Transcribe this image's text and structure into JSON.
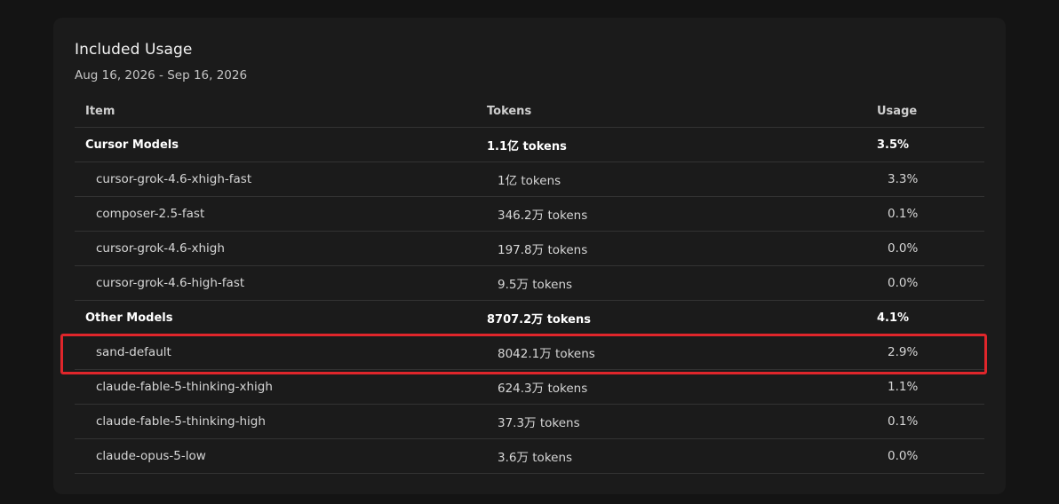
{
  "usage": {
    "title": "Included Usage",
    "date_range": "Aug 16, 2026 - Sep 16, 2026",
    "headers": {
      "item": "Item",
      "tokens": "Tokens",
      "usage": "Usage"
    },
    "groups": [
      {
        "name": "Cursor Models",
        "tokens": "1.1亿 tokens",
        "usage": "3.5%",
        "items": [
          {
            "name": "cursor-grok-4.6-xhigh-fast",
            "tokens": "1亿 tokens",
            "usage": "3.3%"
          },
          {
            "name": "composer-2.5-fast",
            "tokens": "346.2万 tokens",
            "usage": "0.1%"
          },
          {
            "name": "cursor-grok-4.6-xhigh",
            "tokens": "197.8万 tokens",
            "usage": "0.0%"
          },
          {
            "name": "cursor-grok-4.6-high-fast",
            "tokens": "9.5万 tokens",
            "usage": "0.0%"
          }
        ]
      },
      {
        "name": "Other Models",
        "tokens": "8707.2万 tokens",
        "usage": "4.1%",
        "items": [
          {
            "name": "sand-default",
            "tokens": "8042.1万 tokens",
            "usage": "2.9%"
          },
          {
            "name": "claude-fable-5-thinking-xhigh",
            "tokens": "624.3万 tokens",
            "usage": "1.1%"
          },
          {
            "name": "claude-fable-5-thinking-high",
            "tokens": "37.3万 tokens",
            "usage": "0.1%"
          },
          {
            "name": "claude-opus-5-low",
            "tokens": "3.6万 tokens",
            "usage": "0.0%"
          }
        ]
      }
    ]
  },
  "highlight_color": "#e0262b"
}
